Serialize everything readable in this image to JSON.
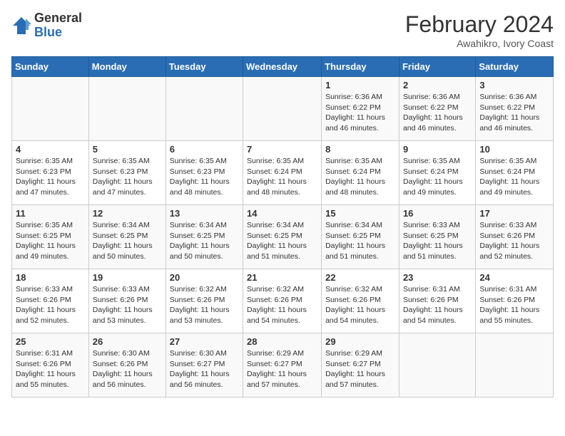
{
  "header": {
    "logo_general": "General",
    "logo_blue": "Blue",
    "title": "February 2024",
    "subtitle": "Awahikro, Ivory Coast"
  },
  "days_of_week": [
    "Sunday",
    "Monday",
    "Tuesday",
    "Wednesday",
    "Thursday",
    "Friday",
    "Saturday"
  ],
  "weeks": [
    [
      {
        "day": "",
        "info": ""
      },
      {
        "day": "",
        "info": ""
      },
      {
        "day": "",
        "info": ""
      },
      {
        "day": "",
        "info": ""
      },
      {
        "day": "1",
        "info": "Sunrise: 6:36 AM\nSunset: 6:22 PM\nDaylight: 11 hours and 46 minutes."
      },
      {
        "day": "2",
        "info": "Sunrise: 6:36 AM\nSunset: 6:22 PM\nDaylight: 11 hours and 46 minutes."
      },
      {
        "day": "3",
        "info": "Sunrise: 6:36 AM\nSunset: 6:22 PM\nDaylight: 11 hours and 46 minutes."
      }
    ],
    [
      {
        "day": "4",
        "info": "Sunrise: 6:35 AM\nSunset: 6:23 PM\nDaylight: 11 hours and 47 minutes."
      },
      {
        "day": "5",
        "info": "Sunrise: 6:35 AM\nSunset: 6:23 PM\nDaylight: 11 hours and 47 minutes."
      },
      {
        "day": "6",
        "info": "Sunrise: 6:35 AM\nSunset: 6:23 PM\nDaylight: 11 hours and 48 minutes."
      },
      {
        "day": "7",
        "info": "Sunrise: 6:35 AM\nSunset: 6:24 PM\nDaylight: 11 hours and 48 minutes."
      },
      {
        "day": "8",
        "info": "Sunrise: 6:35 AM\nSunset: 6:24 PM\nDaylight: 11 hours and 48 minutes."
      },
      {
        "day": "9",
        "info": "Sunrise: 6:35 AM\nSunset: 6:24 PM\nDaylight: 11 hours and 49 minutes."
      },
      {
        "day": "10",
        "info": "Sunrise: 6:35 AM\nSunset: 6:24 PM\nDaylight: 11 hours and 49 minutes."
      }
    ],
    [
      {
        "day": "11",
        "info": "Sunrise: 6:35 AM\nSunset: 6:25 PM\nDaylight: 11 hours and 49 minutes."
      },
      {
        "day": "12",
        "info": "Sunrise: 6:34 AM\nSunset: 6:25 PM\nDaylight: 11 hours and 50 minutes."
      },
      {
        "day": "13",
        "info": "Sunrise: 6:34 AM\nSunset: 6:25 PM\nDaylight: 11 hours and 50 minutes."
      },
      {
        "day": "14",
        "info": "Sunrise: 6:34 AM\nSunset: 6:25 PM\nDaylight: 11 hours and 51 minutes."
      },
      {
        "day": "15",
        "info": "Sunrise: 6:34 AM\nSunset: 6:25 PM\nDaylight: 11 hours and 51 minutes."
      },
      {
        "day": "16",
        "info": "Sunrise: 6:33 AM\nSunset: 6:25 PM\nDaylight: 11 hours and 51 minutes."
      },
      {
        "day": "17",
        "info": "Sunrise: 6:33 AM\nSunset: 6:26 PM\nDaylight: 11 hours and 52 minutes."
      }
    ],
    [
      {
        "day": "18",
        "info": "Sunrise: 6:33 AM\nSunset: 6:26 PM\nDaylight: 11 hours and 52 minutes."
      },
      {
        "day": "19",
        "info": "Sunrise: 6:33 AM\nSunset: 6:26 PM\nDaylight: 11 hours and 53 minutes."
      },
      {
        "day": "20",
        "info": "Sunrise: 6:32 AM\nSunset: 6:26 PM\nDaylight: 11 hours and 53 minutes."
      },
      {
        "day": "21",
        "info": "Sunrise: 6:32 AM\nSunset: 6:26 PM\nDaylight: 11 hours and 54 minutes."
      },
      {
        "day": "22",
        "info": "Sunrise: 6:32 AM\nSunset: 6:26 PM\nDaylight: 11 hours and 54 minutes."
      },
      {
        "day": "23",
        "info": "Sunrise: 6:31 AM\nSunset: 6:26 PM\nDaylight: 11 hours and 54 minutes."
      },
      {
        "day": "24",
        "info": "Sunrise: 6:31 AM\nSunset: 6:26 PM\nDaylight: 11 hours and 55 minutes."
      }
    ],
    [
      {
        "day": "25",
        "info": "Sunrise: 6:31 AM\nSunset: 6:26 PM\nDaylight: 11 hours and 55 minutes."
      },
      {
        "day": "26",
        "info": "Sunrise: 6:30 AM\nSunset: 6:26 PM\nDaylight: 11 hours and 56 minutes."
      },
      {
        "day": "27",
        "info": "Sunrise: 6:30 AM\nSunset: 6:27 PM\nDaylight: 11 hours and 56 minutes."
      },
      {
        "day": "28",
        "info": "Sunrise: 6:29 AM\nSunset: 6:27 PM\nDaylight: 11 hours and 57 minutes."
      },
      {
        "day": "29",
        "info": "Sunrise: 6:29 AM\nSunset: 6:27 PM\nDaylight: 11 hours and 57 minutes."
      },
      {
        "day": "",
        "info": ""
      },
      {
        "day": "",
        "info": ""
      }
    ]
  ]
}
